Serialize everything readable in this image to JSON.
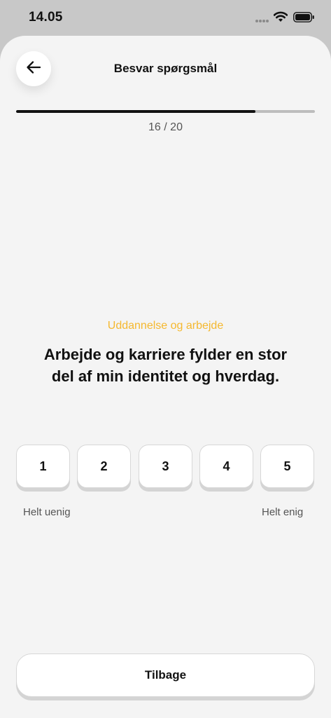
{
  "status_bar": {
    "time": "14.05",
    "icons": [
      "signal-icon",
      "wifi-icon",
      "battery-icon"
    ]
  },
  "header": {
    "title": "Besvar spørgsmål",
    "back_icon": "arrow-left-icon"
  },
  "progress": {
    "current": 16,
    "total": 20,
    "label": "16 / 20",
    "fraction": 0.8
  },
  "question": {
    "category": "Uddannelse og arbejde",
    "text": "Arbejde og karriere fylder en stor del af min identitet og hverdag."
  },
  "scale": {
    "options": [
      "1",
      "2",
      "3",
      "4",
      "5"
    ],
    "min_label": "Helt uenig",
    "max_label": "Helt enig"
  },
  "footer": {
    "back_label": "Tilbage"
  },
  "colors": {
    "accent": "#f5b82e",
    "background": "#f4f4f4",
    "text": "#111111"
  }
}
